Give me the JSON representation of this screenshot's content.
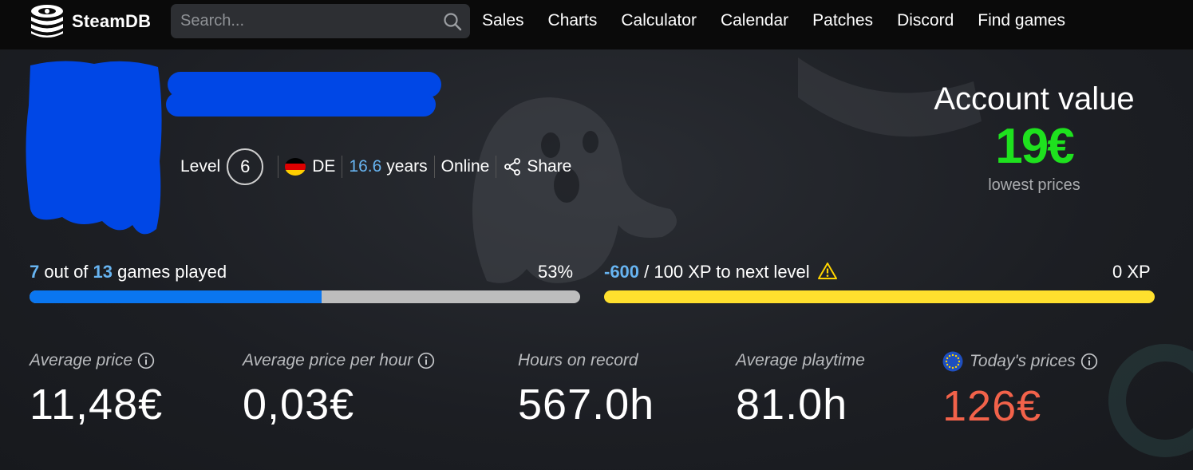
{
  "nav": {
    "brand": "SteamDB",
    "search_placeholder": "Search...",
    "links": [
      "Sales",
      "Charts",
      "Calculator",
      "Calendar",
      "Patches",
      "Discord",
      "Find games"
    ]
  },
  "profile": {
    "level_label": "Level",
    "level": "6",
    "country": "DE",
    "years_num": "16.6",
    "years_unit": "years",
    "status": "Online",
    "share_label": "Share"
  },
  "account": {
    "title": "Account value",
    "value": "19€",
    "subtitle": "lowest prices"
  },
  "games_progress": {
    "played": "7",
    "out_of_text": "out of",
    "total": "13",
    "suffix": "games played",
    "percent_label": "53%",
    "fraction": 0.53
  },
  "xp_progress": {
    "current": "-600",
    "rest": "/ 100 XP to next level",
    "right_label": "0 XP",
    "fraction": 1.0
  },
  "stats": [
    {
      "label": "Average price",
      "value": "11,48€"
    },
    {
      "label": "Average price per hour",
      "value": "0,03€"
    },
    {
      "label": "Hours on record",
      "value": "567.0h"
    },
    {
      "label": "Average playtime",
      "value": "81.0h"
    },
    {
      "label": "Today's prices",
      "value": "126€"
    }
  ],
  "colors": {
    "accent_blue": "#0a76f0",
    "value_green": "#1ee11e",
    "xp_yellow": "#ffe02e",
    "today_red": "#f2624a",
    "track_gray": "#bdbdbd",
    "highlight_blue": "#67b4f1"
  }
}
